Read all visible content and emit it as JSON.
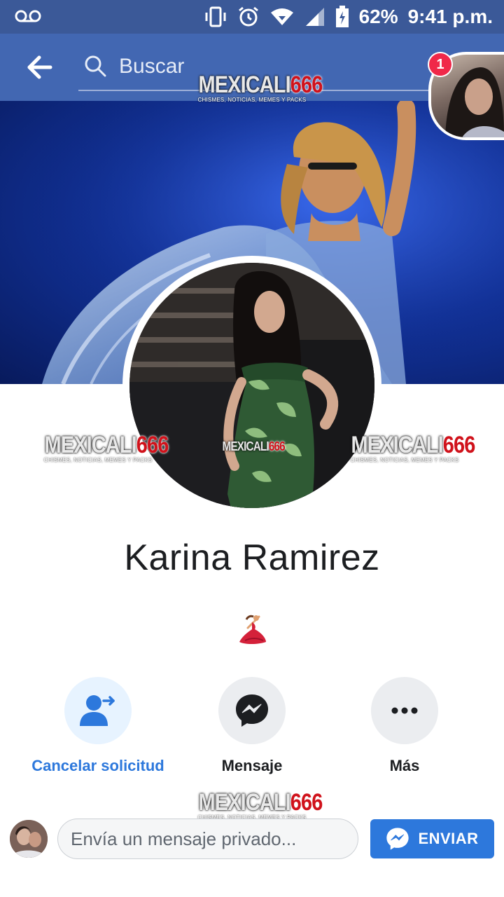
{
  "status_bar": {
    "battery": "62%",
    "time": "9:41 p.m.",
    "icons": [
      "voicemail-icon",
      "vibrate-icon",
      "alarm-icon",
      "wifi-icon",
      "signal-icon",
      "battery-icon"
    ]
  },
  "header": {
    "search_placeholder": "Buscar",
    "notification_count": "1"
  },
  "watermark": {
    "brand_a": "MEXICALI",
    "brand_b": "666",
    "tagline": "CHISMES, NOTICIAS, MEMES Y PACKS"
  },
  "profile": {
    "name": "Karina Ramirez",
    "bio_icon": "dancer-emoji"
  },
  "actions": [
    {
      "label": "Cancelar solicitud",
      "icon": "cancel-request-icon"
    },
    {
      "label": "Mensaje",
      "icon": "messenger-icon"
    },
    {
      "label": "Más",
      "icon": "more-icon"
    }
  ],
  "message_bar": {
    "placeholder": "Envía un mensaje privado...",
    "send_label": "ENVIAR"
  },
  "colors": {
    "status_bar": "#3b5998",
    "top_bar": "#4267b2",
    "accent": "#2d78dc",
    "badge": "#f02849"
  }
}
